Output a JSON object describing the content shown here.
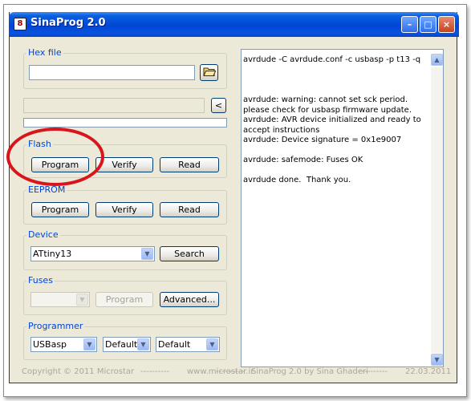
{
  "window": {
    "icon_glyph": "8",
    "title": "SinaProg 2.0",
    "controls": {
      "minimize": "–",
      "maximize": "□",
      "close": "×"
    }
  },
  "hex": {
    "label": "Hex file",
    "value": "",
    "browse_icon": "folder-open-icon",
    "collapse_label": "<",
    "progress": 0
  },
  "flash": {
    "label": "Flash",
    "program": "Program",
    "verify": "Verify",
    "read": "Read"
  },
  "eeprom": {
    "label": "EEPROM",
    "program": "Program",
    "verify": "Verify",
    "read": "Read"
  },
  "device": {
    "label": "Device",
    "selected": "ATtiny13",
    "search": "Search"
  },
  "fuses": {
    "label": "Fuses",
    "selected": "",
    "program": "Program",
    "advanced": "Advanced..."
  },
  "programmer": {
    "label": "Programmer",
    "type": "USBasp",
    "port": "Default",
    "speed": "Default"
  },
  "log": {
    "text": "avrdude -C avrdude.conf -c usbasp -p t13 -q\n\n\n\navrdude: warning: cannot set sck period. please check for usbasp firmware update.\navrdude: AVR device initialized and ready to accept instructions\navrdude: Device signature = 0x1e9007\n\navrdude: safemode: Fuses OK\n\navrdude done.  Thank you.",
    "scroll_up": "▲",
    "scroll_down": "▼"
  },
  "status": {
    "copyright": "Copyright © 2011 Microstar",
    "sep1": "----------",
    "website": "www.microstar.ir",
    "sep2": "----------",
    "version": "SinaProg 2.0  by  Sina Ghaderi",
    "sep3": "----------",
    "date": "22.03.2011"
  },
  "colors": {
    "title_bar": "#0046d5",
    "group_label": "#0046d5",
    "annotation": "#d8151b",
    "window_face": "#ece9d8"
  }
}
